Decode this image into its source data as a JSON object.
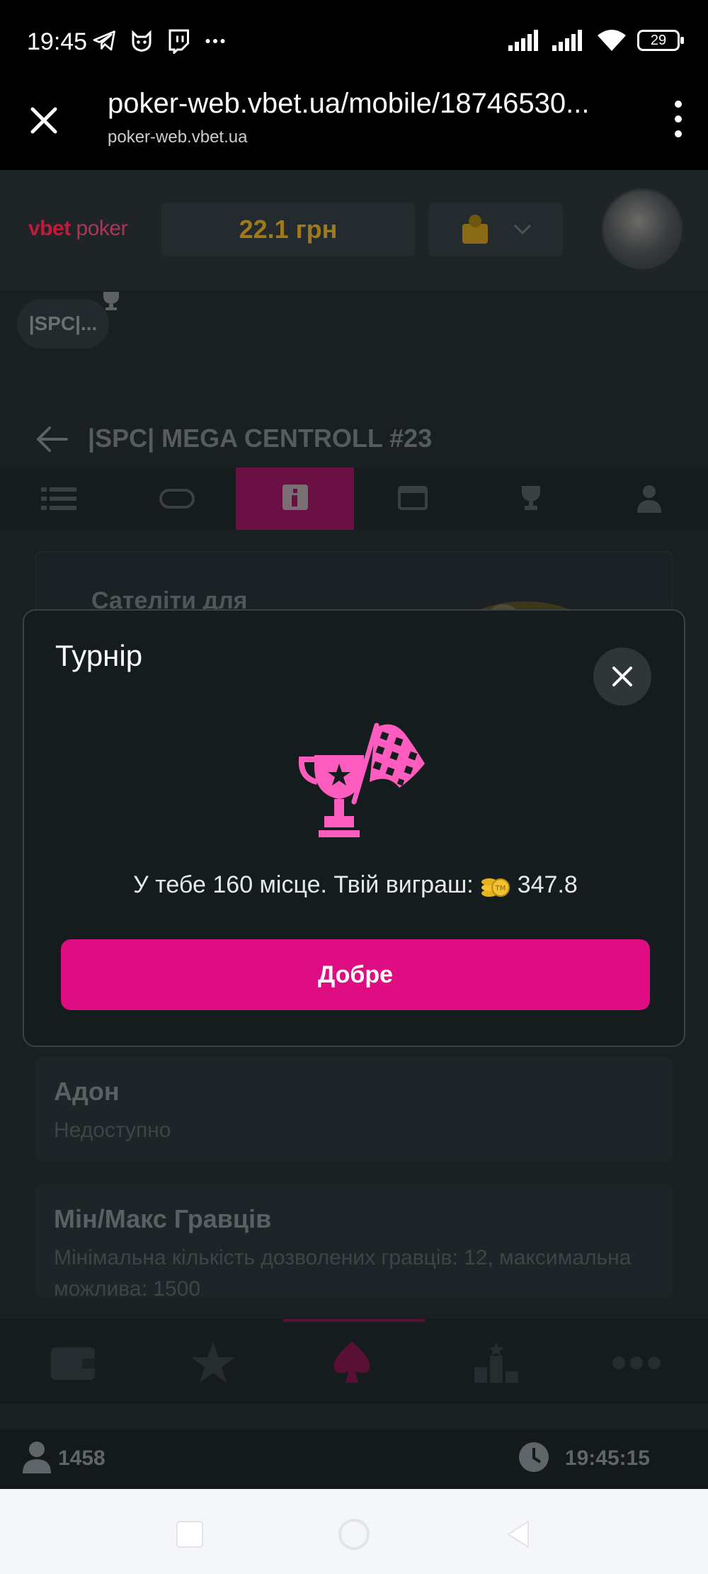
{
  "status_bar": {
    "time": "19:45",
    "battery": "29",
    "app_icons": [
      "telegram-icon",
      "fox-app-icon",
      "twitch-icon",
      "more-dots-icon"
    ]
  },
  "browser": {
    "url": "poker-web.vbet.ua/mobile/18746530...",
    "host": "poker-web.vbet.ua"
  },
  "header": {
    "logo_brand": "vbet",
    "logo_product": "poker",
    "balance": "22.1 грн"
  },
  "tournament_chip": {
    "label": "|SPC|..."
  },
  "tournament": {
    "title": "|SPC| MEGA CENTROLL #23",
    "tabs": [
      "list",
      "ticket",
      "info",
      "table",
      "trophy",
      "player"
    ],
    "active_tab": "info"
  },
  "banner": {
    "text": "Сателіти для"
  },
  "addon": {
    "title": "Адон",
    "value": "Недоступно"
  },
  "players": {
    "title": "Мін/Макс Гравців",
    "text": "Мінімальна кількість дозволених гравців: 12, максимальна можлива: 1500"
  },
  "footer": {
    "online": "1458",
    "clock": "19:45:15"
  },
  "modal": {
    "title": "Турнір",
    "message_prefix": "У тебе 160 місце. Твій виграш:",
    "amount": "347.8",
    "ok_button": "Добре",
    "icon": "trophy-checkered-flag-icon",
    "accent_color": "#df0d82",
    "icon_color": "#ff5cc0"
  }
}
